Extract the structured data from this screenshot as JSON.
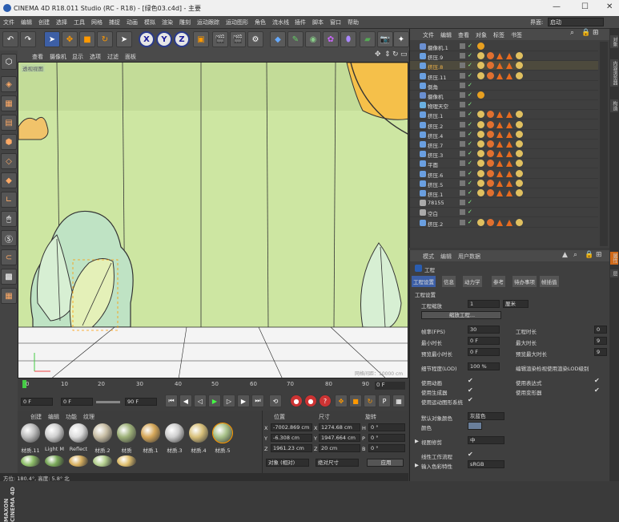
{
  "titlebar": {
    "title": "CINEMA 4D R18.011 Studio (RC - R18) - [绿色03.c4d] - 主要",
    "min": "—",
    "max": "☐",
    "close": "✕"
  },
  "menubar": {
    "items": [
      "文件",
      "编辑",
      "创建",
      "选择",
      "工具",
      "网格",
      "捕捉",
      "动画",
      "模拟",
      "渲染",
      "雕刻",
      "运动跟踪",
      "运动图形",
      "角色",
      "流水线",
      "插件",
      "脚本",
      "窗口",
      "帮助"
    ],
    "interface_label": "界面:",
    "interface_value": "启动"
  },
  "viewport": {
    "menu": [
      "查看",
      "摄像机",
      "显示",
      "选项",
      "过滤",
      "面板"
    ],
    "camera_label": "透视视图",
    "grid_info": "网格间距：10000 cm"
  },
  "timeline": {
    "ticks": [
      "0",
      "10",
      "20",
      "30",
      "40",
      "50",
      "60",
      "70",
      "80",
      "90"
    ],
    "frame_end": "0 F"
  },
  "playbar": {
    "start": "0 F",
    "cur": "0 F",
    "end": "90 F",
    "end2": "90 F"
  },
  "materials": {
    "menu": [
      "创建",
      "编辑",
      "功能",
      "纹理"
    ],
    "items": [
      {
        "name": "材质.11",
        "color": "#bdbdbd"
      },
      {
        "name": "Light M",
        "color": "#cfcfcf"
      },
      {
        "name": "Reflect",
        "color": "#dcdcdc"
      },
      {
        "name": "材质.2",
        "color": "#c9bfa6"
      },
      {
        "name": "材质",
        "color": "#9fb27a"
      },
      {
        "name": "材质.1",
        "color": "#d6a85a"
      },
      {
        "name": "材质.3",
        "color": "#cfcfcf"
      },
      {
        "name": "材质.4",
        "color": "#d8c07a"
      },
      {
        "name": "材质.5",
        "color": "#a9c28a"
      }
    ],
    "row2": [
      "#8fbf6a",
      "#7aa85a",
      "#d8b060",
      "#b5d090",
      "#e0c070"
    ]
  },
  "coords": {
    "headers": [
      "位置",
      "尺寸",
      "旋转"
    ],
    "rows": [
      {
        "axis": "X",
        "pos": "-7002.869 cm",
        "size": "1274.68 cm",
        "rot_axis": "H",
        "rot": "0 °"
      },
      {
        "axis": "Y",
        "pos": "-6.308 cm",
        "size": "1947.664 cm",
        "rot_axis": "P",
        "rot": "0 °"
      },
      {
        "axis": "Z",
        "pos": "1961.23 cm",
        "size": "20 cm",
        "rot_axis": "B",
        "rot": "0 °"
      }
    ],
    "mode1": "对象 (相对)",
    "mode2": "绝对尺寸",
    "apply": "应用"
  },
  "status": "方位: 180.4°, 高度: 5.8° 北",
  "objects": {
    "menu": [
      "文件",
      "编辑",
      "查看",
      "对象",
      "标签",
      "书签"
    ],
    "rows": [
      {
        "name": "摄像机.1",
        "icon": "#6a8fd0"
      },
      {
        "name": "挤压.9",
        "icon": "#6a9fe0"
      },
      {
        "name": "挤压.8",
        "icon": "#6a9fe0"
      },
      {
        "name": "挤压.11",
        "icon": "#6a9fe0"
      },
      {
        "name": "倒角",
        "icon": "#6a9fe0"
      },
      {
        "name": "摄像机",
        "icon": "#6a8fd0"
      },
      {
        "name": "物理天空",
        "icon": "#6ab0e0"
      },
      {
        "name": "挤压.1",
        "icon": "#6a9fe0"
      },
      {
        "name": "挤压.2",
        "icon": "#6a9fe0"
      },
      {
        "name": "挤压.4",
        "icon": "#6a9fe0"
      },
      {
        "name": "挤压.7",
        "icon": "#6a9fe0"
      },
      {
        "name": "挤压.3",
        "icon": "#6a9fe0"
      },
      {
        "name": "平面",
        "icon": "#6a9fe0"
      },
      {
        "name": "挤压.6",
        "icon": "#6a9fe0"
      },
      {
        "name": "挤压.5",
        "icon": "#6a9fe0"
      },
      {
        "name": "挤压.1",
        "icon": "#6a9fe0"
      },
      {
        "name": "78155",
        "icon": "#aaaaaa"
      },
      {
        "name": "空白",
        "icon": "#aaaaaa"
      },
      {
        "name": "挤压.2",
        "icon": "#6a9fe0"
      }
    ]
  },
  "attributes": {
    "menu": [
      "模式",
      "编辑",
      "用户数据"
    ],
    "title": "工程",
    "tabs": [
      "工程设置",
      "信息",
      "动力学",
      "参考",
      "待办事项",
      "帧插值"
    ],
    "section": "工程设置",
    "scale_label": "工程缩放",
    "scale_value": "1",
    "scale_unit": "厘米",
    "scale_btn": "缩放工程...",
    "fps_label": "帧率(FPS)",
    "fps": "30",
    "len_label": "工程时长",
    "len": "0",
    "min_label": "最小时长",
    "min": "0 F",
    "max_label": "最大时长",
    "max": "9",
    "pmin_label": "预览最小时长",
    "pmin": "0 F",
    "pmax_label": "预览最大时长",
    "pmax": "9",
    "lod_label": "细节程度(LOD)",
    "lod": "100 %",
    "lod2_label": "编辑渲染检视使用渲染LOD级别",
    "anim_label": "使用动画",
    "expr_label": "使用表达式",
    "gen_label": "使用生成器",
    "deform_label": "使用变形器",
    "mograph_label": "使用运动图形系统",
    "defcolor_label": "默认对象颜色",
    "defcolor": "灰蓝色",
    "color_label": "颜色",
    "view_label": "视图修剪",
    "view": "中",
    "linear_label": "线性工作流程",
    "input_label": "输入色彩特性",
    "input": "sRGB"
  },
  "rightstrip": [
    "对象",
    "内容浏览器",
    "构造",
    "属性",
    "层"
  ]
}
